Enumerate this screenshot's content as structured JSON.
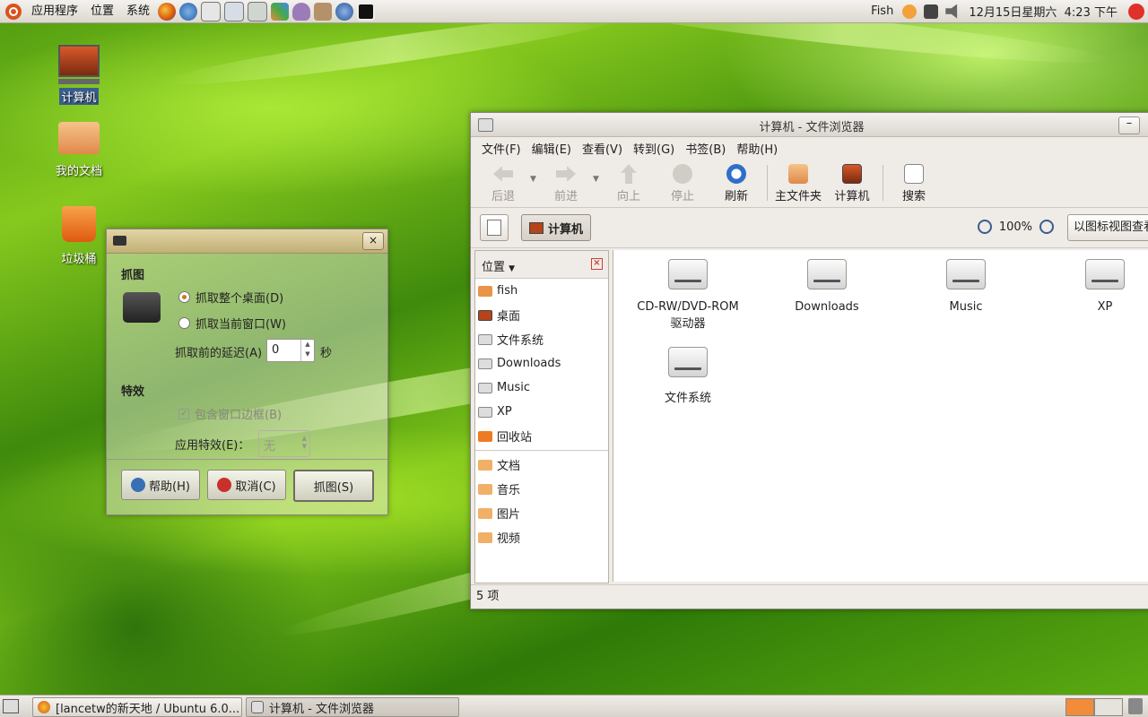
{
  "top_panel": {
    "menus": [
      "应用程序",
      "位置",
      "系统"
    ],
    "tray_text": "Fish",
    "clock": "12月15日星期六  4:23 下午"
  },
  "desktop": {
    "icons": [
      {
        "label": "计算机"
      },
      {
        "label": "我的文档"
      },
      {
        "label": "垃圾桶"
      }
    ]
  },
  "file_manager": {
    "title": "计算机 - 文件浏览器",
    "min_glyph": "–",
    "menu": [
      "文件(F)",
      "编辑(E)",
      "查看(V)",
      "转到(G)",
      "书签(B)",
      "帮助(H)"
    ],
    "toolbar": {
      "back": "后退",
      "forward": "前进",
      "up": "向上",
      "stop": "停止",
      "reload": "刷新",
      "home": "主文件夹",
      "computer": "计算机",
      "search": "搜索"
    },
    "path_button": "计算机",
    "zoom": "100%",
    "view_mode": "以图标视图查看",
    "sidebar": {
      "header": "位置",
      "close_glyph": "×",
      "items_a": [
        "fish",
        "桌面",
        "文件系统",
        "Downloads",
        "Music",
        "XP",
        "回收站"
      ],
      "items_b": [
        "文档",
        "音乐",
        "图片",
        "视频"
      ]
    },
    "drives": [
      {
        "label": "CD-RW/DVD-ROM 驱动器"
      },
      {
        "label": "Downloads"
      },
      {
        "label": "Music"
      },
      {
        "label": "XP"
      },
      {
        "label": "文件系统"
      }
    ],
    "status": "5 项"
  },
  "screenshot_dialog": {
    "close_glyph": "×",
    "section_capture": "抓图",
    "opt_desktop": "抓取整个桌面(D)",
    "opt_window": "抓取当前窗口(W)",
    "delay_label": "抓取前的延迟(A)",
    "delay_value": "0",
    "delay_unit": "秒",
    "section_effects": "特效",
    "border_label": "包含窗口边框(B)",
    "effect_label": "应用特效(E)：",
    "effect_value": "无",
    "help": "帮助(H)",
    "cancel": "取消(C)",
    "capture": "抓图(S)"
  },
  "taskbar": {
    "tasks": [
      "[lancetw的新天地 / Ubuntu 6.0...",
      "计算机 - 文件浏览器"
    ]
  }
}
